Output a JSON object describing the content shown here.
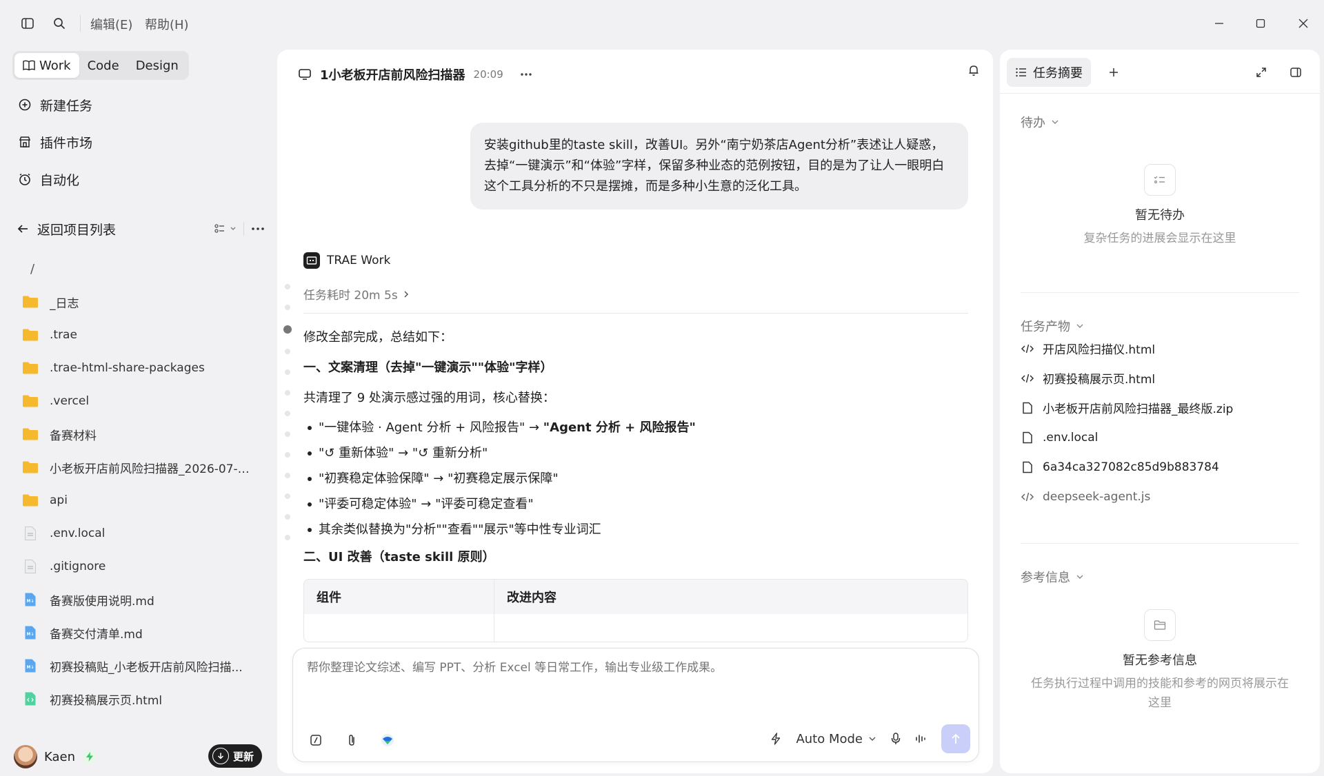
{
  "titlebar": {
    "menu": [
      "编辑(E)",
      "帮助(H)"
    ]
  },
  "sidebar": {
    "modes": [
      {
        "label": "Work",
        "active": true
      },
      {
        "label": "Code",
        "active": false
      },
      {
        "label": "Design",
        "active": false
      }
    ],
    "nav": [
      {
        "label": "新建任务",
        "icon": "plus-circle-icon"
      },
      {
        "label": "插件市场",
        "icon": "store-icon"
      },
      {
        "label": "自动化",
        "icon": "clock-icon"
      }
    ],
    "back_label": "返回项目列表",
    "root": "/",
    "files": [
      {
        "name": "_日志",
        "type": "folder"
      },
      {
        "name": ".trae",
        "type": "folder"
      },
      {
        "name": ".trae-html-share-packages",
        "type": "folder"
      },
      {
        "name": ".vercel",
        "type": "folder"
      },
      {
        "name": "备赛材料",
        "type": "folder"
      },
      {
        "name": "小老板开店前风险扫描器_2026-07-1...",
        "type": "folder"
      },
      {
        "name": "api",
        "type": "folder"
      },
      {
        "name": ".env.local",
        "type": "file"
      },
      {
        "name": ".gitignore",
        "type": "file"
      },
      {
        "name": "备赛版使用说明.md",
        "type": "md"
      },
      {
        "name": "备赛交付清单.md",
        "type": "md"
      },
      {
        "name": "初赛投稿贴_小老板开店前风险扫描...",
        "type": "md"
      },
      {
        "name": "初赛投稿展示页.html",
        "type": "html"
      }
    ],
    "user": {
      "name": "Kaen"
    },
    "update_label": "更新"
  },
  "center": {
    "title": "1小老板开店前风险扫描器",
    "time": "20:09",
    "user_message": "安装github里的taste skill，改善UI。另外“南宁奶茶店Agent分析”表述让人疑惑，去掉“一键演示”和“体验”字样，保留多种业态的范例按钮，目的是为了让人一眼明白这个工具分析的不只是摆摊，而是多种小生意的泛化工具。",
    "agent_name": "TRAE Work",
    "duration": "任务耗时 20m 5s",
    "summary_intro": "修改全部完成，总结如下：",
    "section1_title": "一、文案清理（去掉\"一键演示\"\"体验\"字样）",
    "section1_text": "共清理了 9 处演示感过强的用词，核心替换：",
    "bullets": [
      {
        "from": "\"一键体验 · Agent 分析 + 风险报告\" → ",
        "to": "\"Agent 分析 + 风险报告\""
      },
      {
        "from": "\"↺ 重新体验\" → \"↺ 重新分析\"",
        "to": ""
      },
      {
        "from": "\"初赛稳定体验保障\" → \"初赛稳定展示保障\"",
        "to": ""
      },
      {
        "from": "\"评委可稳定体验\" → \"评委可稳定查看\"",
        "to": ""
      },
      {
        "from": "其余类似替换为\"分析\"\"查看\"\"展示\"等中性专业词汇",
        "to": ""
      }
    ],
    "section2_title": "二、UI 改善（taste skill 原则）",
    "table_headers": [
      "组件",
      "改进内容"
    ],
    "composer": {
      "placeholder": "帮你整理论文综述、编写 PPT、分析 Excel 等日常工作，输出专业级工作成果。",
      "mode": "Auto Mode"
    }
  },
  "right": {
    "tab_label": "任务摘要",
    "todo": {
      "title": "待办",
      "empty_title": "暂无待办",
      "empty_sub": "复杂任务的进展会显示在这里"
    },
    "artifacts": {
      "title": "任务产物",
      "items": [
        {
          "name": "开店风险扫描仪.html",
          "icon": "code-icon",
          "muted": false
        },
        {
          "name": "初赛投稿展示页.html",
          "icon": "code-icon",
          "muted": false
        },
        {
          "name": "小老板开店前风险扫描器_最终版.zip",
          "icon": "file-icon",
          "muted": false
        },
        {
          "name": ".env.local",
          "icon": "file-icon",
          "muted": false
        },
        {
          "name": "6a34ca327082c85d9b883784",
          "icon": "file-icon",
          "muted": false
        },
        {
          "name": "deepseek-agent.js",
          "icon": "code-icon",
          "muted": true
        }
      ]
    },
    "references": {
      "title": "参考信息",
      "empty_title": "暂无参考信息",
      "empty_sub": "任务执行过程中调用的技能和参考的网页将展示在这里"
    }
  }
}
